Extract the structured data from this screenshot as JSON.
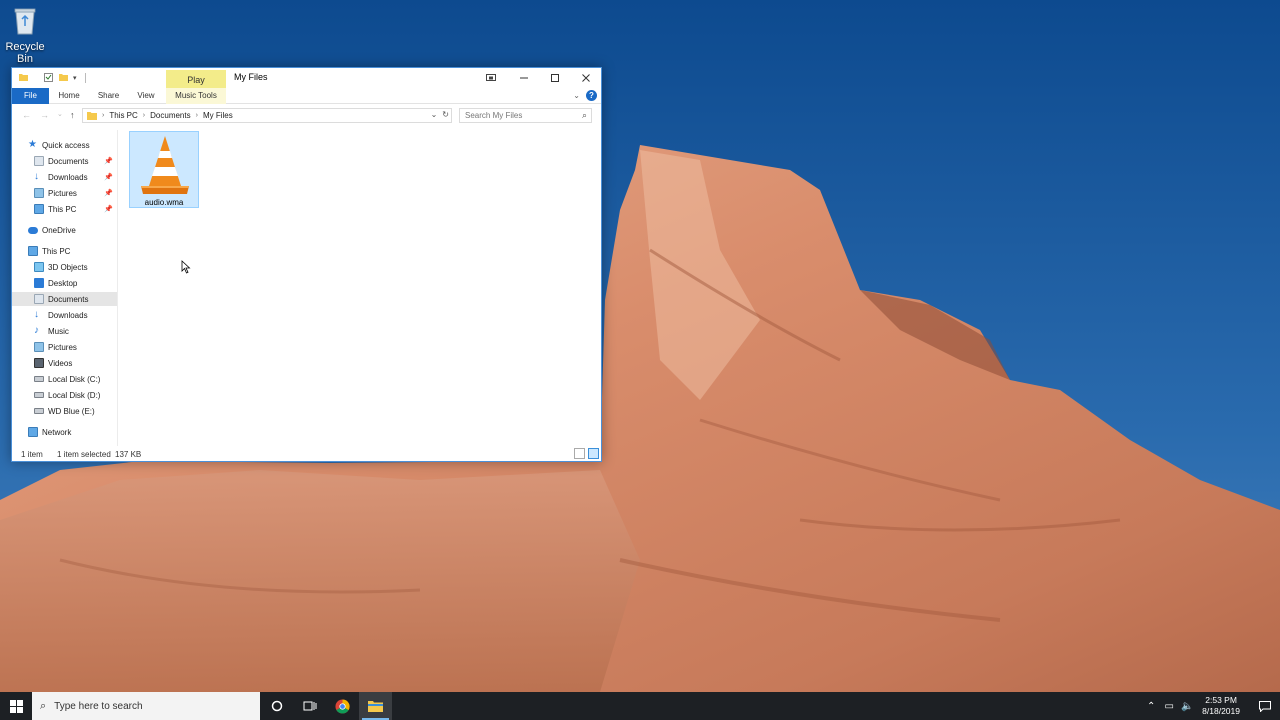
{
  "desktop": {
    "recycle_bin_label": "Recycle Bin"
  },
  "window": {
    "title": "My Files",
    "contextual_tab": "Play",
    "ribbon_tabs": {
      "file": "File",
      "home": "Home",
      "share": "Share",
      "view": "View",
      "music_tools": "Music Tools"
    },
    "help_label": "?",
    "address": {
      "crumbs": [
        "This PC",
        "Documents",
        "My Files"
      ]
    },
    "search": {
      "placeholder": "Search My Files"
    },
    "nav": {
      "quick_access": "Quick access",
      "qa_documents": "Documents",
      "qa_downloads": "Downloads",
      "qa_pictures": "Pictures",
      "qa_this_pc": "This PC",
      "onedrive": "OneDrive",
      "this_pc": "This PC",
      "objects3d": "3D Objects",
      "desktop": "Desktop",
      "documents": "Documents",
      "downloads": "Downloads",
      "music": "Music",
      "pictures": "Pictures",
      "videos": "Videos",
      "local_c": "Local Disk (C:)",
      "local_d": "Local Disk (D:)",
      "wd_blue": "WD Blue (E:)",
      "network": "Network"
    },
    "files": [
      {
        "name": "audio.wma",
        "icon": "vlc-cone-icon",
        "selected": true
      }
    ],
    "status": {
      "count": "1 item",
      "selected": "1 item selected",
      "size": "137 KB"
    }
  },
  "taskbar": {
    "search_placeholder": "Type here to search",
    "time": "2:53 PM",
    "date": "8/18/2019"
  },
  "colors": {
    "accent": "#1a6ac6",
    "selection": "#cce8ff",
    "play_tab": "#f3ec8a",
    "taskbar": "#1d2024"
  }
}
